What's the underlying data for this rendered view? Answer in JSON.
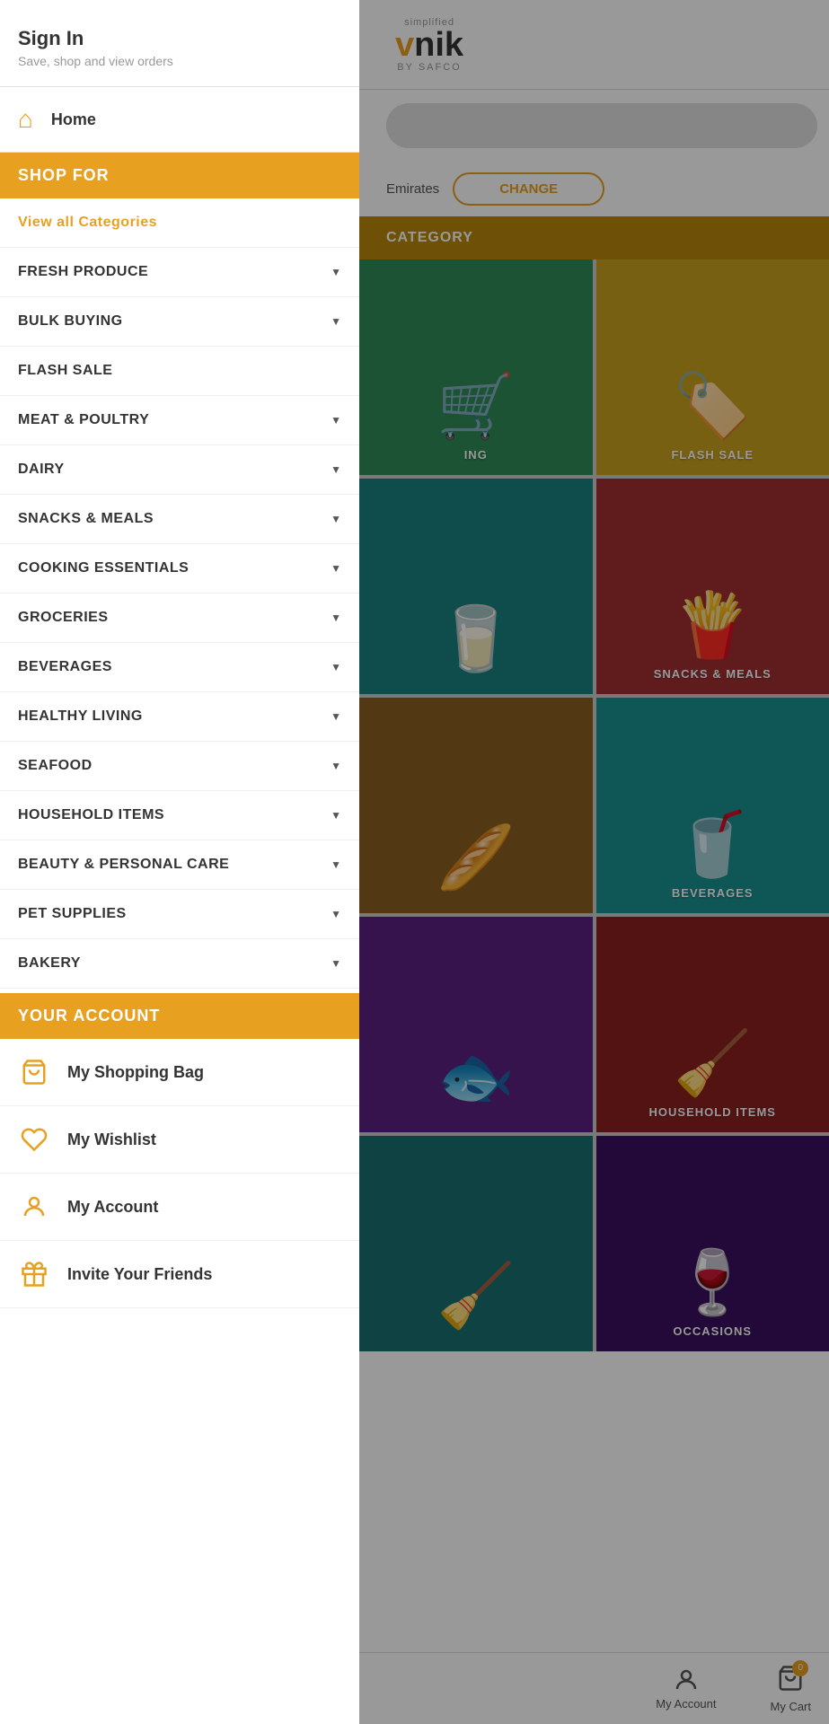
{
  "app": {
    "logo": {
      "simplified": "simplified",
      "brand_orange": "v",
      "brand_dark": "nik",
      "by_safco": "BY SAFCO"
    }
  },
  "header": {
    "sign_in_title": "Sign In",
    "sign_in_subtitle": "Save, shop and view orders"
  },
  "home_item": {
    "label": "Home"
  },
  "shop_for": {
    "title": "SHOP FOR"
  },
  "menu_items": [
    {
      "label": "View all Categories",
      "special": true,
      "has_arrow": false
    },
    {
      "label": "FRESH PRODUCE",
      "special": false,
      "has_arrow": true
    },
    {
      "label": "BULK BUYING",
      "special": false,
      "has_arrow": true
    },
    {
      "label": "FLASH SALE",
      "special": false,
      "has_arrow": false
    },
    {
      "label": "MEAT & POULTRY",
      "special": false,
      "has_arrow": true
    },
    {
      "label": "DAIRY",
      "special": false,
      "has_arrow": true
    },
    {
      "label": "SNACKS & MEALS",
      "special": false,
      "has_arrow": true
    },
    {
      "label": "COOKING ESSENTIALS",
      "special": false,
      "has_arrow": true
    },
    {
      "label": "GROCERIES",
      "special": false,
      "has_arrow": true
    },
    {
      "label": "BEVERAGES",
      "special": false,
      "has_arrow": true
    },
    {
      "label": "HEALTHY LIVING",
      "special": false,
      "has_arrow": true
    },
    {
      "label": "SEAFOOD",
      "special": false,
      "has_arrow": true
    },
    {
      "label": "HOUSEHOLD ITEMS",
      "special": false,
      "has_arrow": true
    },
    {
      "label": "BEAUTY & PERSONAL CARE",
      "special": false,
      "has_arrow": true
    },
    {
      "label": "PET SUPPLIES",
      "special": false,
      "has_arrow": true
    },
    {
      "label": "BAKERY",
      "special": false,
      "has_arrow": true
    }
  ],
  "your_account": {
    "title": "YOUR ACCOUNT"
  },
  "account_items": [
    {
      "label": "My Shopping Bag",
      "icon": "bag"
    },
    {
      "label": "My Wishlist",
      "icon": "heart"
    },
    {
      "label": "My Account",
      "icon": "user"
    },
    {
      "label": "Invite Your Friends",
      "icon": "gift"
    }
  ],
  "location": {
    "text": "Emirates",
    "change_label": "CHANGE"
  },
  "category_section": {
    "header": "CATEGORY"
  },
  "category_tiles": [
    {
      "label": "ING",
      "color": "green"
    },
    {
      "label": "FLASH SALE",
      "color": "gold"
    },
    {
      "label": "",
      "color": "teal"
    },
    {
      "label": "SNACKS & MEALS",
      "color": "red-brown"
    },
    {
      "label": "",
      "color": "brown"
    },
    {
      "label": "BEVERAGES",
      "color": "teal2"
    },
    {
      "label": "",
      "color": "purple"
    },
    {
      "label": "HOUSEHOLD ITEMS",
      "color": "dark-red"
    },
    {
      "label": "",
      "color": "teal3"
    },
    {
      "label": "OCCASIONS",
      "color": "dark-purple"
    }
  ],
  "bottom_nav": {
    "account_label": "My Account",
    "cart_label": "My Cart",
    "cart_badge": "0"
  }
}
